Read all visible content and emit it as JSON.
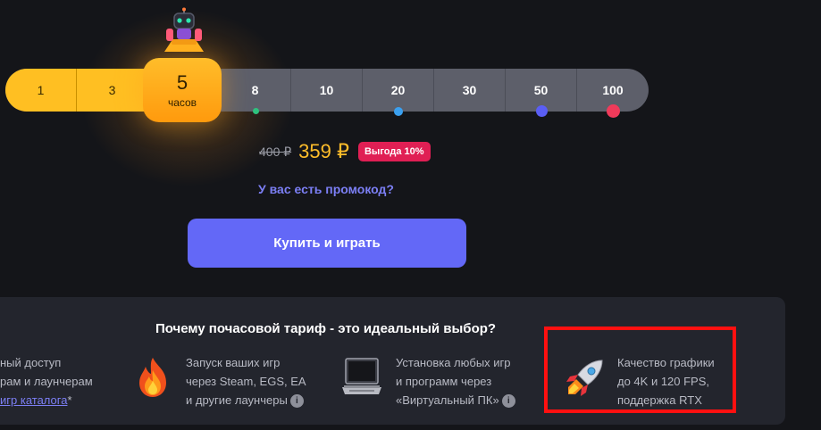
{
  "mascot": {
    "icon": "robot-mascot-icon"
  },
  "hours_slider": {
    "options": [
      "1",
      "3",
      "5",
      "8",
      "10",
      "20",
      "30",
      "50",
      "100"
    ],
    "selected_value": "5",
    "selected_unit": "часов",
    "bonus_dot_colors": {
      "8": "#2ec27e",
      "20": "#3aa0f0",
      "50": "#5a5ef5",
      "100": "#f03a5a"
    }
  },
  "pricing": {
    "old_price": "400 ₽",
    "new_price": "359 ₽",
    "discount_badge": "Выгода 10%"
  },
  "promo_link": "У вас есть промокод?",
  "buy_button": "Купить и играть",
  "features": {
    "title": "Почему почасовой тариф - это идеальный выбор?",
    "items": [
      {
        "icon": "cropped-icon",
        "line1": "ный доступ",
        "line2": "рам и лаунчерам",
        "link": "игр каталога",
        "suffix": "*"
      },
      {
        "icon": "fire-icon",
        "line1": "Запуск ваших игр",
        "line2": "через Steam, EGS, EA",
        "line3": "и другие лаунчеры",
        "info_icon": "i"
      },
      {
        "icon": "laptop-icon",
        "line1": "Установка любых игр",
        "line2": "и программ через",
        "line3": "«Виртуальный ПК»",
        "info_icon": "i"
      },
      {
        "icon": "rocket-icon",
        "line1": "Качество графики",
        "line2": "до 4K и 120 FPS,",
        "line3": "поддержка RTX"
      }
    ]
  },
  "colors": {
    "accent_orange": "#ffbd2a",
    "accent_purple": "#6368f7",
    "badge_red": "#e01f54",
    "highlight_red": "#ff1010"
  }
}
